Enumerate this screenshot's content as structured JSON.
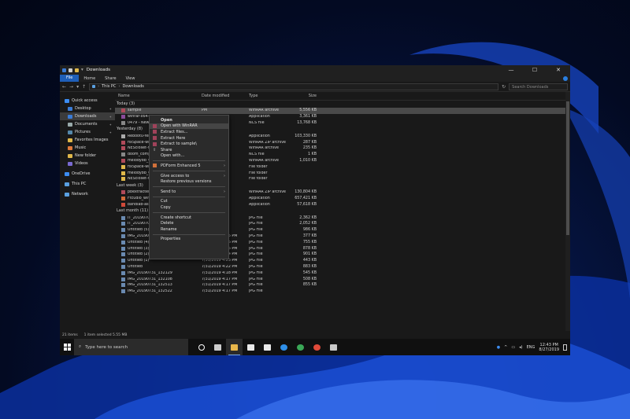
{
  "window": {
    "title": "Downloads",
    "controls": [
      "—",
      "☐",
      "✕"
    ]
  },
  "ribbon": {
    "tabs": [
      "File",
      "Home",
      "Share",
      "View"
    ]
  },
  "address": {
    "path": [
      "This PC",
      "Downloads"
    ],
    "search_placeholder": "Search Downloads"
  },
  "sidebar": {
    "items": [
      {
        "label": "Quick access",
        "icon": "star-icon",
        "color": "#3c8cf0"
      },
      {
        "label": "Desktop",
        "icon": "folder-icon",
        "color": "#3a7bd5",
        "pinned": true
      },
      {
        "label": "Downloads",
        "icon": "download-icon",
        "color": "#3a7bd5",
        "pinned": true,
        "selected": true
      },
      {
        "label": "Documents",
        "icon": "document-icon",
        "color": "#9aa",
        "pinned": true
      },
      {
        "label": "Pictures",
        "icon": "picture-icon",
        "color": "#58a",
        "pinned": true
      },
      {
        "label": "Favorites Images",
        "icon": "folder-icon",
        "color": "#e0b84a"
      },
      {
        "label": "Music",
        "icon": "music-icon",
        "color": "#e07a3a"
      },
      {
        "label": "New folder",
        "icon": "folder-icon",
        "color": "#e0b84a"
      },
      {
        "label": "Videos",
        "icon": "video-icon",
        "color": "#7a6ad0"
      },
      {
        "label": "OneDrive",
        "icon": "cloud-icon",
        "color": "#3c8cf0"
      },
      {
        "label": "This PC",
        "icon": "computer-icon",
        "color": "#5aa0e0"
      },
      {
        "label": "Network",
        "icon": "network-icon",
        "color": "#5aa0e0"
      }
    ]
  },
  "columns": {
    "name": "Name",
    "date": "Date modified",
    "type": "Type",
    "size": "Size"
  },
  "groups": [
    {
      "label": "Today (3)",
      "rows": [
        {
          "name": "sample",
          "date": "PM",
          "type": "WinRAR archive",
          "size": "5,556 KB",
          "color": "#b04a5a",
          "highlight": true
        },
        {
          "name": "winrar-x64-5",
          "date": "PM",
          "type": "Application",
          "size": "3,361 KB",
          "color": "#8a4a9a"
        },
        {
          "name": "0479 - New S",
          "date": "PM",
          "type": "NCS File",
          "size": "13,768 KB",
          "color": "#888"
        }
      ]
    },
    {
      "label": "Yesterday (8)",
      "rows": [
        {
          "name": "Rebootu-ferst",
          "date": "PM",
          "type": "Application",
          "size": "103,330 KB",
          "color": "#aaa"
        },
        {
          "name": "fixSpace-win",
          "date": "PM",
          "type": "WinRAR ZIP archive",
          "size": "287 KB",
          "color": "#b04a5a"
        },
        {
          "name": "NEScloset-nex",
          "date": "PM",
          "type": "WinRAR archive",
          "size": "235 KB",
          "color": "#b04a5a"
        },
        {
          "name": "doom_compute",
          "date": "PM",
          "type": "NCS File",
          "size": "1 KB",
          "color": "#888"
        },
        {
          "name": "melody8b_CA",
          "date": "PM",
          "type": "WinRAR archive",
          "size": "1,010 KB",
          "color": "#b04a5a"
        },
        {
          "name": "fixSpace-win",
          "date": "PM",
          "type": "File folder",
          "size": "",
          "color": "#e0b84a"
        },
        {
          "name": "melody8b_CA",
          "date": "PM",
          "type": "File folder",
          "size": "",
          "color": "#e0b84a"
        },
        {
          "name": "NEScloset-nex",
          "date": "PM",
          "type": "File folder",
          "size": "",
          "color": "#e0b84a"
        }
      ]
    },
    {
      "label": "Last week (3)",
      "rows": [
        {
          "name": "pbextracter_2",
          "date": "PM",
          "type": "WinRAR ZIP archive",
          "size": "130,804 KB",
          "color": "#b04a5a"
        },
        {
          "name": "Ftcudio_win_2",
          "date": "PM",
          "type": "Application",
          "size": "657,421 KB",
          "color": "#d06a3a"
        },
        {
          "name": "bandlab-assis",
          "date": "PM",
          "type": "Application",
          "size": "57,618 KB",
          "color": "#d04a3a"
        }
      ]
    },
    {
      "label": "Last month (11)",
      "rows": [
        {
          "name": "IT_20190704_",
          "date": "PM",
          "type": "JPG File",
          "size": "2,362 KB",
          "color": "#6a8ab0"
        },
        {
          "name": "IT_20190704_1",
          "date": "PM",
          "type": "JPG File",
          "size": "2,052 KB",
          "color": "#6a8ab0"
        },
        {
          "name": "Untitled (5)",
          "date": "PM",
          "type": "JPG File",
          "size": "986 KB",
          "color": "#6a8ab0"
        },
        {
          "name": "IMG_20190731_125226",
          "date": "7/31/2019 4:35 PM",
          "type": "JPG File",
          "size": "377 KB",
          "color": "#6a8ab0"
        },
        {
          "name": "Untitled (4)",
          "date": "7/31/2019 4:26 PM",
          "type": "JPG File",
          "size": "755 KB",
          "color": "#6a8ab0"
        },
        {
          "name": "Untitled (3)",
          "date": "7/31/2019 4:25 PM",
          "type": "JPG File",
          "size": "878 KB",
          "color": "#6a8ab0"
        },
        {
          "name": "Untitled (2)",
          "date": "7/31/2019 4:24 PM",
          "type": "JPG File",
          "size": "901 KB",
          "color": "#6a8ab0"
        },
        {
          "name": "Untitled (1)",
          "date": "7/31/2019 4:23 PM",
          "type": "JPG File",
          "size": "443 KB",
          "color": "#6a8ab0"
        },
        {
          "name": "Untitled",
          "date": "7/31/2019 4:22 PM",
          "type": "JPG File",
          "size": "883 KB",
          "color": "#6a8ab0"
        },
        {
          "name": "IMG_20190731_132129",
          "date": "7/31/2019 4:18 PM",
          "type": "JPG File",
          "size": "545 KB",
          "color": "#6a8ab0"
        },
        {
          "name": "IMG_20190731_132108",
          "date": "7/31/2019 4:17 PM",
          "type": "JPG File",
          "size": "508 KB",
          "color": "#6a8ab0"
        },
        {
          "name": "IMG_20190731_132513",
          "date": "7/31/2019 4:17 PM",
          "type": "JPG File",
          "size": "855 KB",
          "color": "#6a8ab0"
        },
        {
          "name": "IMG_20190731_132522",
          "date": "7/31/2019 4:17 PM",
          "type": "JPG File",
          "size": "",
          "color": "#6a8ab0"
        }
      ]
    }
  ],
  "context_menu": {
    "items": [
      {
        "label": "Open",
        "bold": true
      },
      {
        "label": "Open with WinRAR",
        "icon": "winrar-icon",
        "highlight": true
      },
      {
        "label": "Extract files...",
        "icon": "winrar-icon"
      },
      {
        "label": "Extract Here",
        "icon": "winrar-icon"
      },
      {
        "label": "Extract to sample\\",
        "icon": "winrar-icon"
      },
      {
        "label": "Share",
        "icon": "share-icon"
      },
      {
        "label": "Open with..."
      },
      {
        "sep": true
      },
      {
        "label": "PDForm Enhanced 5",
        "icon": "pdf-icon",
        "arrow": true
      },
      {
        "sep": true
      },
      {
        "label": "Give access to",
        "arrow": true
      },
      {
        "label": "Restore previous versions"
      },
      {
        "sep": true
      },
      {
        "label": "Send to",
        "arrow": true
      },
      {
        "sep": true
      },
      {
        "label": "Cut"
      },
      {
        "label": "Copy"
      },
      {
        "sep": true
      },
      {
        "label": "Create shortcut"
      },
      {
        "label": "Delete"
      },
      {
        "label": "Rename"
      },
      {
        "sep": true
      },
      {
        "label": "Properties"
      }
    ]
  },
  "status": {
    "count": "21 items",
    "selected": "1 item selected  5.55 MB"
  },
  "taskbar": {
    "search_placeholder": "Type here to search",
    "apps": [
      {
        "name": "cortana-icon",
        "color": "#ffffff"
      },
      {
        "name": "task-view-icon",
        "color": "#cccccc"
      },
      {
        "name": "file-explorer-icon",
        "color": "#e8b64a",
        "active": true
      },
      {
        "name": "store-icon",
        "color": "#e8e8e8"
      },
      {
        "name": "mail-icon",
        "color": "#e8e8e8"
      },
      {
        "name": "edge-icon",
        "color": "#2f8fe8"
      },
      {
        "name": "chrome-icon",
        "color": "#3aa757"
      },
      {
        "name": "opera-icon",
        "color": "#e04a3a"
      },
      {
        "name": "app-icon",
        "color": "#c8c8c8"
      }
    ],
    "lang": "ENG",
    "time": "12:43 PM",
    "date": "8/27/2019"
  }
}
